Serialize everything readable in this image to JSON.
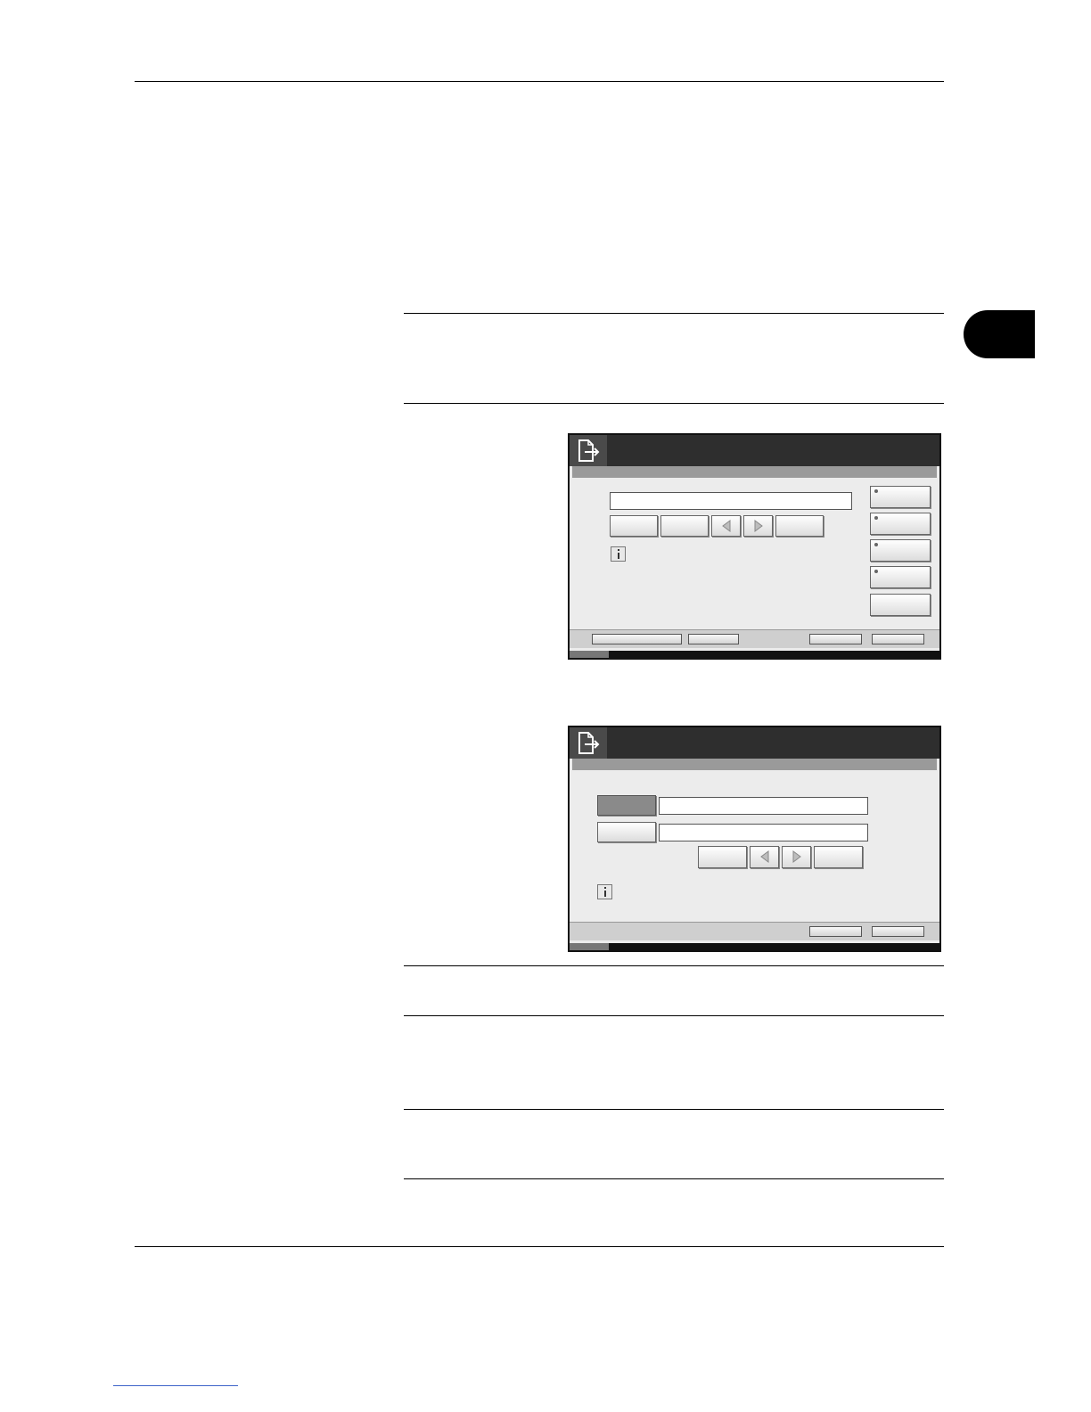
{
  "page": {
    "chapter_tab_color": "#000000",
    "footer_link_color": "#3d63c9"
  },
  "panels": [
    {
      "icon": "document-send-icon",
      "footer_buttons": 4,
      "side_buttons": 5
    },
    {
      "icon": "document-send-icon",
      "footer_buttons": 2
    }
  ]
}
